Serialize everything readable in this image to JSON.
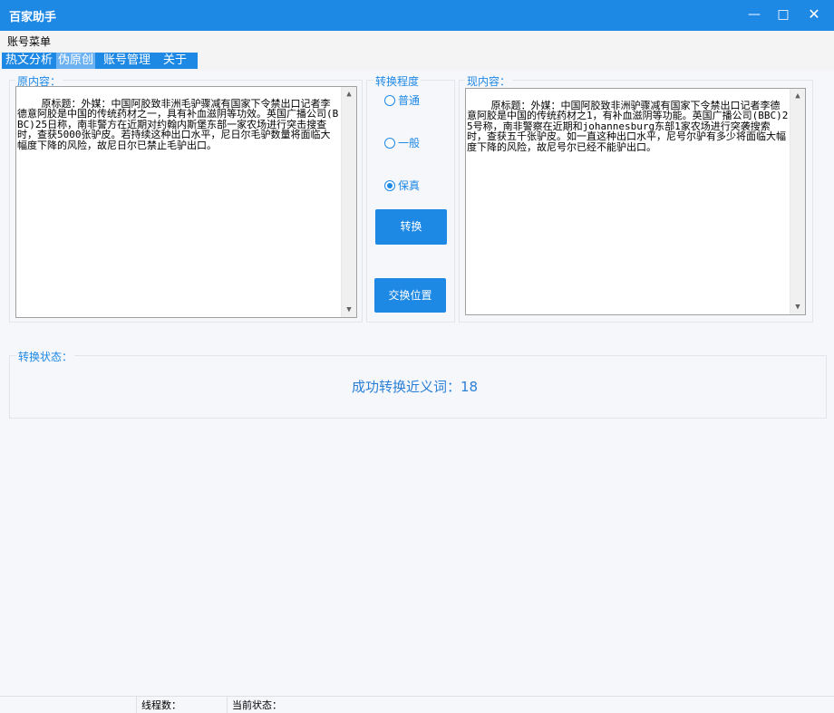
{
  "window": {
    "title": "百家助手",
    "min_icon": "minimize-icon",
    "max_icon": "maximize-icon",
    "close_icon": "close-icon"
  },
  "menubar": {
    "account_menu": "账号菜单"
  },
  "nav": {
    "tabs": [
      {
        "label": "热文分析",
        "active": false
      },
      {
        "label": "伪原创",
        "active": true
      },
      {
        "label": "账号管理",
        "active": false
      },
      {
        "label": "关于",
        "active": false
      }
    ]
  },
  "original": {
    "label": "原内容：",
    "text": "原标题：外媒：中国阿胶致非洲毛驴骤减有国家下令禁出口记者李德意阿胶是中国的传统药材之一，具有补血滋阴等功效。英国广播公司(BBC)25日称，南非警方在近期对约翰内斯堡东部一家农场进行突击搜查时，查获5000张驴皮。若持续这种出口水平，尼日尔毛驴数量将面临大幅度下降的风险，故尼日尔已禁止毛驴出口。"
  },
  "degree": {
    "label": "转换程度",
    "options": [
      {
        "label": "普通",
        "checked": false
      },
      {
        "label": "一般",
        "checked": false
      },
      {
        "label": "保真",
        "checked": true
      }
    ],
    "convert_button": "转换",
    "swap_button": "交换位置"
  },
  "converted": {
    "label": "现内容：",
    "text": "原标题：外媒：中国阿胶致非洲驴骤减有国家下令禁出口记者李德意阿胶是中国的传统药材之1，有补血滋阴等功能。英国广播公司(BBC)25号称，南非警察在近期和johannesburg东部1家农场进行突袭搜索时，查获五千张驴皮。如一直这种出口水平，尼号尔驴有多少将面临大幅度下降的风险，故尼号尔已经不能驴出口。"
  },
  "status": {
    "label": "转换状态：",
    "message": "成功转换近义词：18"
  },
  "footer": {
    "thread_label": "线程数：",
    "state_label": "当前状态："
  },
  "colors": {
    "accent": "#1e88e5",
    "active_tab": "#6cb2f2",
    "status_text": "#2b7fd6"
  }
}
